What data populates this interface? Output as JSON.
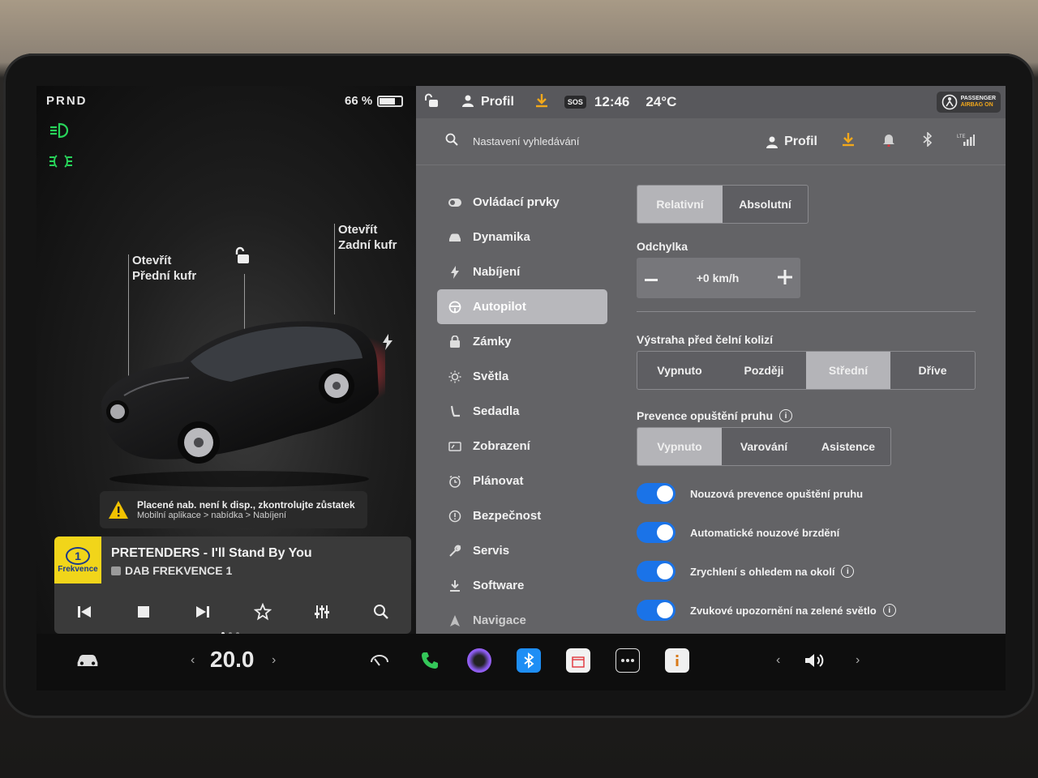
{
  "status": {
    "gear": "PRND",
    "battery": "66 %",
    "battery_level": 0.66
  },
  "car_view": {
    "frunk_label": "Otevřít\nPřední kufr",
    "frunk_line1": "Otevřít",
    "frunk_line2": "Přední kufr",
    "trunk_line1": "Otevřít",
    "trunk_line2": "Zadní kufr"
  },
  "warning": {
    "line1": "Placené nab. není k disp., zkontrolujte zůstatek",
    "line2": "Mobilní aplikace > nabídka > Nabíjení"
  },
  "media": {
    "logo_text": "Frekvence",
    "logo_number": "1",
    "title": "PRETENDERS - I'll Stand By You",
    "station": "DAB FREKVENCE 1"
  },
  "topbar": {
    "profile": "Profil",
    "sos": "SOS",
    "time": "12:46",
    "temp": "24°C",
    "airbag_line1": "PASSENGER",
    "airbag_line2": "AIRBAG ON"
  },
  "search": {
    "placeholder": "Nastavení vyhledávání",
    "profile": "Profil"
  },
  "nav": {
    "items": [
      {
        "label": "Ovládací prvky",
        "icon": "toggle-icon"
      },
      {
        "label": "Dynamika",
        "icon": "car-icon"
      },
      {
        "label": "Nabíjení",
        "icon": "bolt-icon"
      },
      {
        "label": "Autopilot",
        "icon": "steering-wheel-icon"
      },
      {
        "label": "Zámky",
        "icon": "lock-icon"
      },
      {
        "label": "Světla",
        "icon": "sun-icon"
      },
      {
        "label": "Sedadla",
        "icon": "seat-icon"
      },
      {
        "label": "Zobrazení",
        "icon": "display-icon"
      },
      {
        "label": "Plánovat",
        "icon": "clock-icon"
      },
      {
        "label": "Bezpečnost",
        "icon": "shield-icon"
      },
      {
        "label": "Servis",
        "icon": "wrench-icon"
      },
      {
        "label": "Software",
        "icon": "download-icon"
      },
      {
        "label": "Navigace",
        "icon": "navigation-icon"
      }
    ],
    "active": "Autopilot"
  },
  "autopilot": {
    "offset_mode": {
      "options": [
        "Relativní",
        "Absolutní"
      ],
      "selected": "Relativní"
    },
    "offset_label": "Odchylka",
    "offset_value": "+0 km/h",
    "fcw_label": "Výstraha před čelní kolizí",
    "fcw": {
      "options": [
        "Vypnuto",
        "Později",
        "Střední",
        "Dříve"
      ],
      "selected": "Střední"
    },
    "lane_label": "Prevence opuštění pruhu",
    "lane": {
      "options": [
        "Vypnuto",
        "Varování",
        "Asistence"
      ],
      "selected": "Vypnuto"
    },
    "toggles": [
      {
        "label": "Nouzová prevence opuštění pruhu",
        "on": true,
        "info": false
      },
      {
        "label": "Automatické nouzové brzdění",
        "on": true,
        "info": false
      },
      {
        "label": "Zrychlení s ohledem na okolí",
        "on": true,
        "info": true
      },
      {
        "label": "Zvukové upozornění na zelené světlo",
        "on": true,
        "info": true
      }
    ]
  },
  "dock": {
    "temperature": "20.0",
    "colors": {
      "phone": "#34c759",
      "bluetooth": "#1e8ef5",
      "toggle": "#1a73e8",
      "lights": "#28d45a"
    }
  }
}
